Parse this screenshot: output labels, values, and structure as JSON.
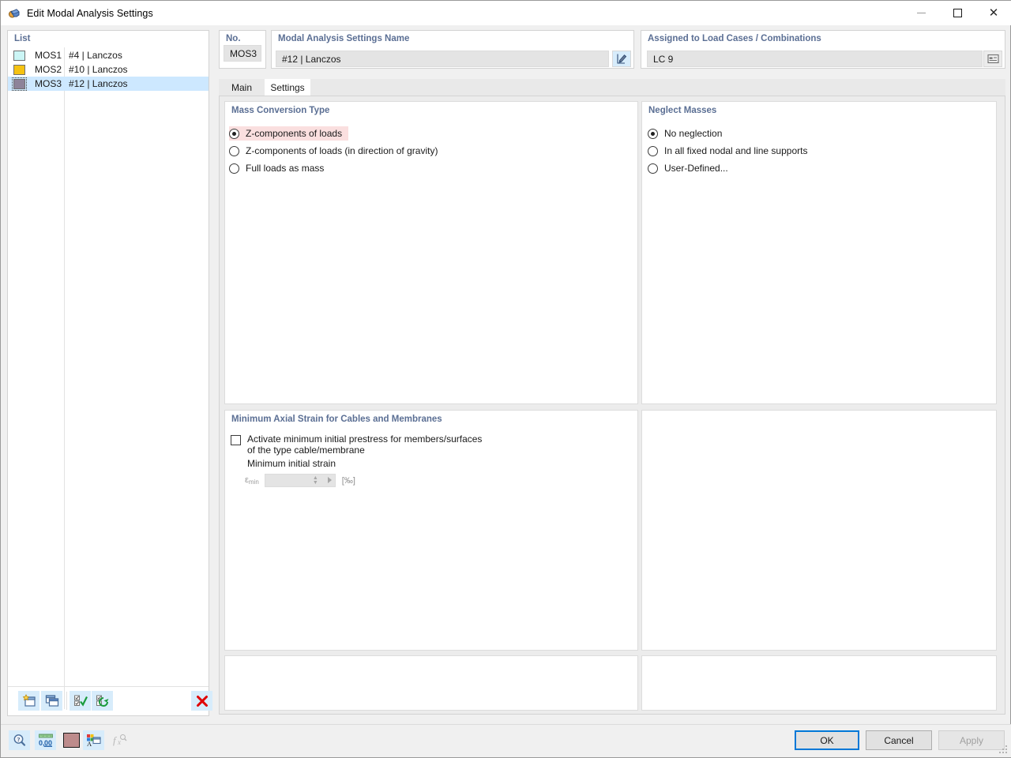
{
  "window": {
    "title": "Edit Modal Analysis Settings",
    "app_icon": "modal-analysis-icon",
    "minimize": "–",
    "maximize": "□",
    "close": "✕"
  },
  "list_panel": {
    "header": "List",
    "rows": [
      {
        "code": "MOS1",
        "name": "#4 | Lanczos",
        "color": "#cbf5f5",
        "selected": false
      },
      {
        "code": "MOS2",
        "name": "#10 | Lanczos",
        "color": "#f5c211",
        "selected": false
      },
      {
        "code": "MOS3",
        "name": "#12 | Lanczos",
        "color": "#8d8399",
        "selected": true
      }
    ],
    "toolbar": [
      {
        "name": "new-item-button",
        "icon": "new-window-star-icon"
      },
      {
        "name": "copy-item-button",
        "icon": "copy-windows-icon"
      },
      {
        "name": "select-all-button",
        "icon": "checklist-check-icon"
      },
      {
        "name": "invert-selection-button",
        "icon": "checklist-swap-icon"
      },
      {
        "name": "delete-item-button",
        "icon": "red-x-icon"
      }
    ]
  },
  "header_fields": {
    "no_label": "No.",
    "no_value": "MOS3",
    "name_label": "Modal Analysis Settings Name",
    "name_value": "#12 | Lanczos",
    "name_edit_icon": "pencil-edit-icon",
    "assigned_label": "Assigned to Load Cases / Combinations",
    "assigned_value": "LC 9",
    "assigned_pick_icon": "table-select-icon"
  },
  "tabs": [
    {
      "label": "Main",
      "active": false
    },
    {
      "label": "Settings",
      "active": true
    }
  ],
  "mass_conversion": {
    "title": "Mass Conversion Type",
    "options": [
      {
        "label": "Z-components of loads",
        "checked": true,
        "highlight": true
      },
      {
        "label": "Z-components of loads (in direction of gravity)",
        "checked": false,
        "highlight": false
      },
      {
        "label": "Full loads as mass",
        "checked": false,
        "highlight": false
      }
    ]
  },
  "neglect_masses": {
    "title": "Neglect Masses",
    "options": [
      {
        "label": "No neglection",
        "checked": true
      },
      {
        "label": "In all fixed nodal and line supports",
        "checked": false
      },
      {
        "label": "User-Defined...",
        "checked": false
      }
    ]
  },
  "min_axial_strain": {
    "title": "Minimum Axial Strain for Cables and Membranes",
    "checkbox_label_line1": "Activate minimum initial prestress for members/surfaces",
    "checkbox_label_line2": "of the type cable/membrane",
    "checkbox_checked": false,
    "sub_label": "Minimum initial strain",
    "symbol": "ε",
    "symbol_sub": "min",
    "value": "",
    "unit": "[‰]",
    "enabled": false
  },
  "bottom_bar": {
    "icons": [
      {
        "name": "help-magnifier-button",
        "icon": "magnifier-question-icon"
      },
      {
        "name": "units-button",
        "icon": "units-0-00-icon"
      },
      {
        "name": "color-swatch-button",
        "icon": "color-swatch-icon",
        "color": "#bd8b8b"
      },
      {
        "name": "display-properties-button",
        "icon": "display-properties-icon"
      },
      {
        "name": "formula-button",
        "icon": "function-fx-icon",
        "disabled": true
      }
    ],
    "ok": "OK",
    "cancel": "Cancel",
    "apply": "Apply",
    "apply_disabled": true
  },
  "colors": {
    "accent_blue": "#0078d7",
    "header_text": "#5b6f94",
    "selection": "#cde8ff",
    "highlight_pink": "#fadfdf",
    "icon_bg": "#d7ecfb"
  }
}
